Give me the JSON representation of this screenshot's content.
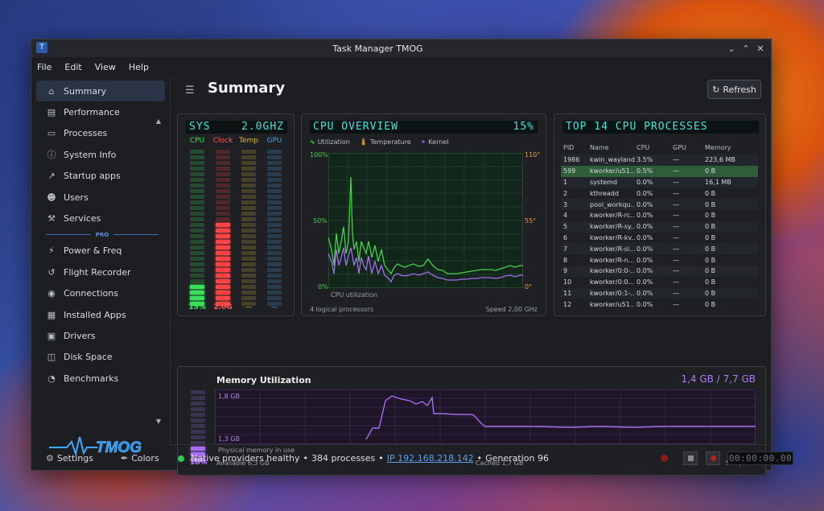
{
  "window": {
    "title": "Task Manager TMOG"
  },
  "menu": [
    "File",
    "Edit",
    "View",
    "Help"
  ],
  "sidebar": {
    "items": [
      {
        "label": "Summary",
        "icon": "home-icon"
      },
      {
        "label": "Performance",
        "icon": "performance-icon"
      },
      {
        "label": "Processes",
        "icon": "list-icon"
      },
      {
        "label": "System Info",
        "icon": "info-icon"
      },
      {
        "label": "Startup apps",
        "icon": "rocket-icon"
      },
      {
        "label": "Users",
        "icon": "users-icon"
      },
      {
        "label": "Services",
        "icon": "wrench-icon"
      }
    ],
    "pro_label": "PRO",
    "pro_items": [
      {
        "label": "Power & Freq",
        "icon": "bolt-icon"
      },
      {
        "label": "Flight Recorder",
        "icon": "recorder-icon"
      },
      {
        "label": "Connections",
        "icon": "globe-icon"
      },
      {
        "label": "Installed Apps",
        "icon": "apps-icon"
      },
      {
        "label": "Drivers",
        "icon": "chip-icon"
      },
      {
        "label": "Disk Space",
        "icon": "disk-icon"
      },
      {
        "label": "Benchmarks",
        "icon": "gauge-icon"
      }
    ],
    "logo_text": "TMOG",
    "settings_label": "Settings",
    "colors_label": "Colors"
  },
  "header": {
    "title": "Summary",
    "refresh_label": "Refresh"
  },
  "sys_panel": {
    "lcd_left": "SYS",
    "lcd_right": "2.0GHZ",
    "bars": [
      {
        "label": "CPU",
        "value": "15%",
        "fraction": 0.15,
        "color": "#39e05a"
      },
      {
        "label": "Clock",
        "value": "2.0G",
        "fraction": 0.52,
        "color": "#ff4444"
      },
      {
        "label": "Temp",
        "value": "—",
        "fraction": 0,
        "color": "#e0b43a"
      },
      {
        "label": "GPU",
        "value": "—",
        "fraction": 0,
        "color": "#4aa3df"
      }
    ]
  },
  "cpu_panel": {
    "lcd_left": "CPU OVERVIEW",
    "lcd_right": "15%",
    "legend": [
      "Utilization",
      "Temperature",
      "Kernel"
    ],
    "y_left": [
      "100%",
      "50%",
      "0%"
    ],
    "y_right": [
      "110°",
      "55°",
      "0°"
    ],
    "caption": "CPU utilization",
    "footer_left": "4 logical processors",
    "footer_right": "Speed 2,00 GHz"
  },
  "top_panel": {
    "lcd_left": "TOP 14 CPU PROCESSES",
    "columns": [
      "PID",
      "Name",
      "CPU",
      "GPU",
      "Memory"
    ],
    "rows": [
      [
        "1986",
        "kwin_wayland",
        "3.5%",
        "—",
        "223,6 MB"
      ],
      [
        "599",
        "kworker/u51...",
        "0.5%",
        "—",
        "0 B"
      ],
      [
        "1",
        "systemd",
        "0.0%",
        "—",
        "16,1 MB"
      ],
      [
        "2",
        "kthreadd",
        "0.0%",
        "—",
        "0 B"
      ],
      [
        "3",
        "pool_workqu...",
        "0.0%",
        "—",
        "0 B"
      ],
      [
        "4",
        "kworker/R-rc...",
        "0.0%",
        "—",
        "0 B"
      ],
      [
        "5",
        "kworker/R-sy...",
        "0.0%",
        "—",
        "0 B"
      ],
      [
        "6",
        "kworker/R-kv...",
        "0.0%",
        "—",
        "0 B"
      ],
      [
        "7",
        "kworker/R-sl...",
        "0.0%",
        "—",
        "0 B"
      ],
      [
        "8",
        "kworker/R-n...",
        "0.0%",
        "—",
        "0 B"
      ],
      [
        "9",
        "kworker/0:0-...",
        "0.0%",
        "—",
        "0 B"
      ],
      [
        "10",
        "kworker/0:0...",
        "0.0%",
        "—",
        "0 B"
      ],
      [
        "11",
        "kworker/0:1-...",
        "0.0%",
        "—",
        "0 B"
      ],
      [
        "12",
        "kworker/u51...",
        "0.0%",
        "—",
        "0 B"
      ]
    ]
  },
  "memory_panel": {
    "title": "Memory Utilization",
    "summary": "1,4 GB / 7,7 GB",
    "percent": "18%",
    "fraction": 0.18,
    "y_top": "1,8 GB",
    "y_bottom": "1,3 GB",
    "caption": "Physical memory in use",
    "available": "Available 6,3 GB",
    "cached": "Cached 1,7 GB",
    "swap": "Swap 0 B"
  },
  "status": {
    "health": "Native providers healthy",
    "processes": "384 processes",
    "ip": "IP 192.168.218.142",
    "generation": "Generation 96",
    "timer": "00:00:00.00"
  },
  "colors": {
    "utilization": "#46d14a",
    "temperature": "#e8a23a",
    "kernel": "#a46cf0",
    "memory": "#a66cf2"
  }
}
